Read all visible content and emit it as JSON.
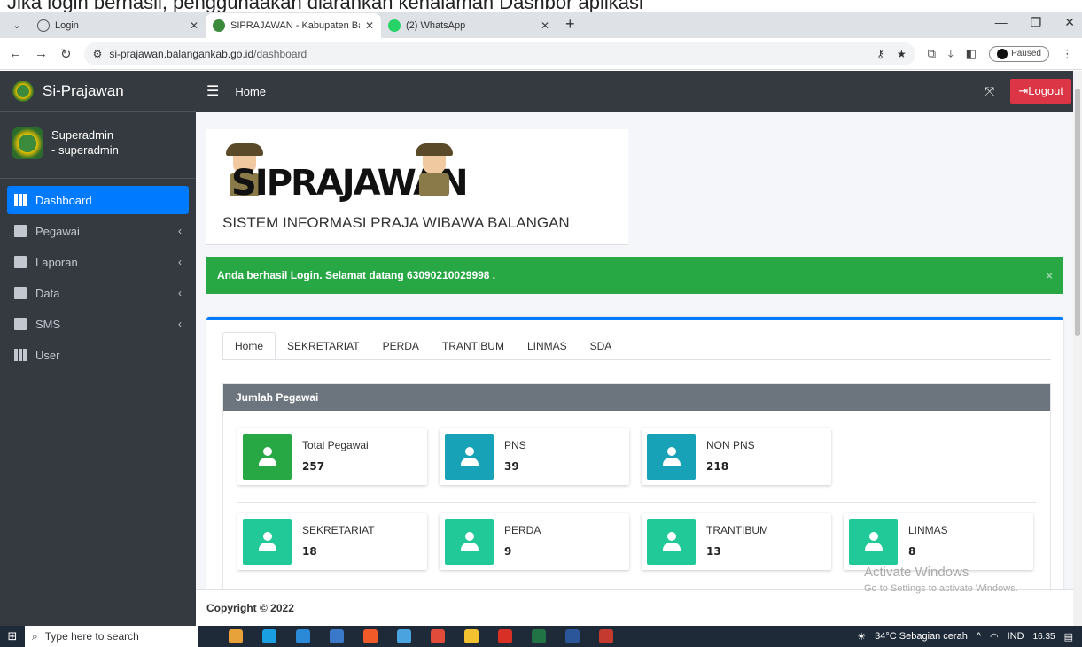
{
  "doc_text": "Jika login berhasil, penggunaakan diarahkan kehalaman Dashbor aplikasi",
  "browser": {
    "tabs": [
      {
        "title": "Login",
        "active": false
      },
      {
        "title": "SIPRAJAWAN - Kabupaten Bala…",
        "active": true
      },
      {
        "title": "(2) WhatsApp",
        "active": false
      }
    ],
    "url_main": "si-prajawan.balangankab.go.id",
    "url_path": "/dashboard",
    "paused_label": "Paused"
  },
  "sidebar": {
    "brand": "Si-Prajawan",
    "user_line1": "Superadmin",
    "user_line2": "- superadmin",
    "items": [
      {
        "label": "Dashboard",
        "icon": "th-icon",
        "active": true
      },
      {
        "label": "Pegawai",
        "icon": "copy-icon"
      },
      {
        "label": "Laporan",
        "icon": "copy-icon"
      },
      {
        "label": "Data",
        "icon": "copy-icon"
      },
      {
        "label": "SMS",
        "icon": "copy-icon"
      },
      {
        "label": "User",
        "icon": "th-icon"
      }
    ]
  },
  "topnav": {
    "home": "Home",
    "logout": "Logout"
  },
  "hero": {
    "logo_text": "SIPRAJAWAN",
    "subtitle": "SISTEM INFORMASI PRAJA WIBAWA BALANGAN"
  },
  "alert": {
    "message": "Anda berhasil Login. Selamat datang 63090210029998 ."
  },
  "card_tabs": [
    "Home",
    "SEKRETARIAT",
    "PERDA",
    "TRANTIBUM",
    "LINMAS",
    "SDA"
  ],
  "panel": {
    "title": "Jumlah Pegawai",
    "row1": [
      {
        "label": "Total Pegawai",
        "value": "257",
        "color": "#28a745"
      },
      {
        "label": "PNS",
        "value": "39",
        "color": "#17a2b8"
      },
      {
        "label": "NON PNS",
        "value": "218",
        "color": "#17a2b8"
      }
    ],
    "row2": [
      {
        "label": "SEKRETARIAT",
        "value": "18",
        "color": "#20c997"
      },
      {
        "label": "PERDA",
        "value": "9",
        "color": "#20c997"
      },
      {
        "label": "TRANTIBUM",
        "value": "13",
        "color": "#20c997"
      },
      {
        "label": "LINMAS",
        "value": "8",
        "color": "#20c997"
      }
    ]
  },
  "footer": "Copyright © 2022",
  "watermark": {
    "line1": "Activate Windows",
    "line2": "Go to Settings to activate Windows."
  },
  "taskbar": {
    "search_placeholder": "Type here to search",
    "weather": "34°C  Sebagian cerah",
    "lang": "IND",
    "time": "16.35"
  }
}
